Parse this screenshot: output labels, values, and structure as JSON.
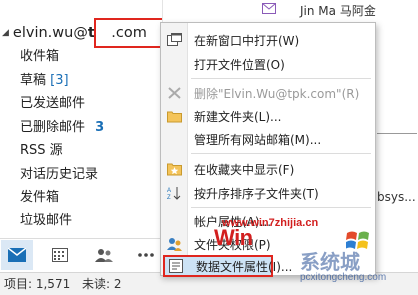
{
  "account": {
    "prefix": "elvin.wu@",
    "obscured": "t ",
    "suffix": ".com"
  },
  "folders": [
    {
      "label": "收件箱",
      "count": ""
    },
    {
      "label": "草稿",
      "count": "[3]"
    },
    {
      "label": "已发送邮件",
      "count": ""
    },
    {
      "label": "已删除邮件",
      "count": "3"
    },
    {
      "label": "RSS 源",
      "count": ""
    },
    {
      "label": "对话历史记录",
      "count": ""
    },
    {
      "label": "发件箱",
      "count": ""
    },
    {
      "label": "垃圾邮件",
      "count": ""
    }
  ],
  "mail": {
    "sender": "Jin Ma 马阿金",
    "fragment": "bsys..."
  },
  "context_menu": {
    "items": [
      {
        "label": "在新窗口中打开(W)",
        "icon": "new-window-icon"
      },
      {
        "label": "打开文件位置(O)",
        "icon": ""
      },
      {
        "label": "删除\"Elvin.Wu@tpk.com\"(R)",
        "icon": "delete-icon",
        "disabled": true
      },
      {
        "label": "新建文件夹(L)...",
        "icon": "new-folder-icon"
      },
      {
        "label": "管理所有网站邮箱(M)...",
        "icon": ""
      },
      {
        "label": "在收藏夹中显示(F)",
        "icon": "favorite-star-icon"
      },
      {
        "label": "按升序排序子文件夹(T)",
        "icon": "sort-ascending-icon"
      },
      {
        "label": "帐户属性(A)...",
        "icon": ""
      },
      {
        "label": "文件夹权限(P)",
        "icon": "permissions-icon"
      },
      {
        "label": "数据文件属性(I)...",
        "icon": "properties-icon"
      }
    ]
  },
  "status": {
    "items_label": "项目: 1,571",
    "unread_label": "未读: 2"
  },
  "watermark": {
    "url": "www.win7zhijia.cn",
    "win7": "Win",
    "cn": "系统城",
    "site": "pcxitongcheng.com"
  },
  "colors": {
    "accent": "#1a6fb6",
    "highlight_border": "#e0261e",
    "watermark_red": "#d21f1f"
  }
}
